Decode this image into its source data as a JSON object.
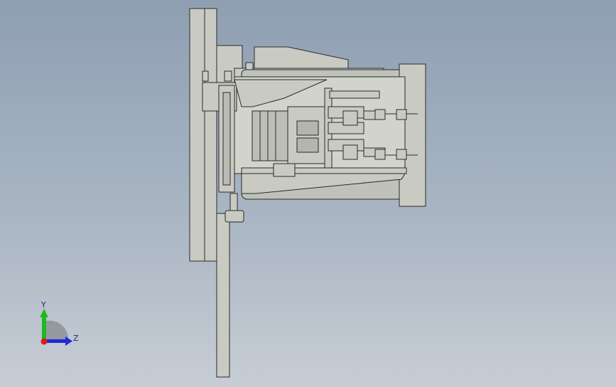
{
  "viewport": {
    "background_top": "#8e9fb2",
    "background_bottom": "#c7cdd5",
    "model_fill": "#c9cbc3",
    "model_edge": "#2a2a2a"
  },
  "triad": {
    "y_label": "Y",
    "z_label": "Z",
    "y_color": "#1fb81f",
    "z_color": "#1d2ad8",
    "x_color": "#d81d1d"
  }
}
